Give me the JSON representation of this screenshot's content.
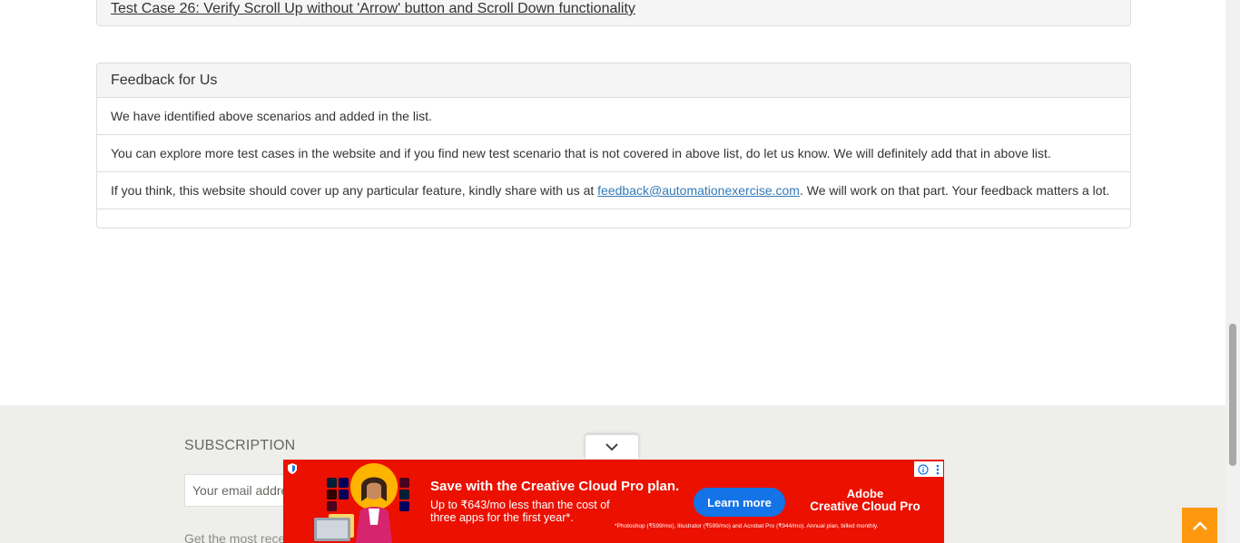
{
  "top_case": {
    "link_text": "Test Case 26: Verify Scroll Up without 'Arrow' button and Scroll Down functionality"
  },
  "feedback": {
    "heading": "Feedback for Us",
    "item_1": "We have identified above scenarios and added in the list.",
    "item_2": "You can explore more test cases in the website and if you find new test scenario that is not covered in above list, do let us know. We will definitely add that in above list.",
    "item_3_before": "If you think, this website should cover up any particular feature, kindly share with us at ",
    "item_3_email": "feedback@automationexercise.com",
    "item_3_after": ". We will work on that part. Your feedback matters a lot."
  },
  "footer": {
    "subscription_title": "SUBSCRIPTION",
    "email_placeholder": "Your email address",
    "note": "Get the most recent updates from"
  },
  "ad": {
    "headline": "Save with the Creative Cloud Pro plan.",
    "subline": "Up to ₹643/mo less than the cost of three apps for the first year*.",
    "button": "Learn more",
    "brand_line1": "Adobe",
    "brand_line2": "Creative Cloud Pro",
    "fineprint": "*Photoshop (₹599/mo), Illustrator (₹599/mo) and Acrobat Pro (₹944/mo). Annual plan, billed monthly.",
    "accent_color": "#eb1000",
    "button_color": "#1473e6"
  },
  "icons": {
    "collapse": "chevron-down-icon",
    "scroll_up": "chevron-up-icon",
    "ad_info": "info-icon",
    "ad_menu": "more-vertical-icon",
    "ad_shield": "shield-icon"
  },
  "colors": {
    "scroll_up_bg": "#fe980f",
    "footer_bg": "#eeeeea",
    "link": "#337ab7"
  }
}
